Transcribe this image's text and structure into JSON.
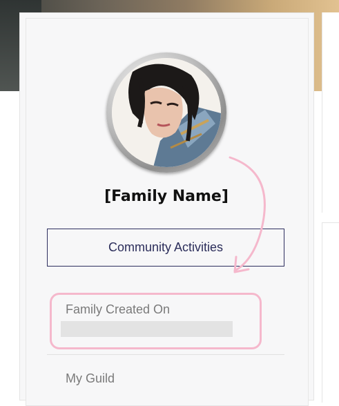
{
  "profile": {
    "family_name": "[Family Name]",
    "community_button_label": "Community Activities",
    "created_label": "Family Created On",
    "guild_label": "My Guild"
  },
  "colors": {
    "highlight": "#f5b8cc",
    "button_border": "#2c2d5e",
    "label_text": "#7a7a7a"
  },
  "icons": {
    "avatar": "character-portrait",
    "annotation": "curved-arrow"
  }
}
